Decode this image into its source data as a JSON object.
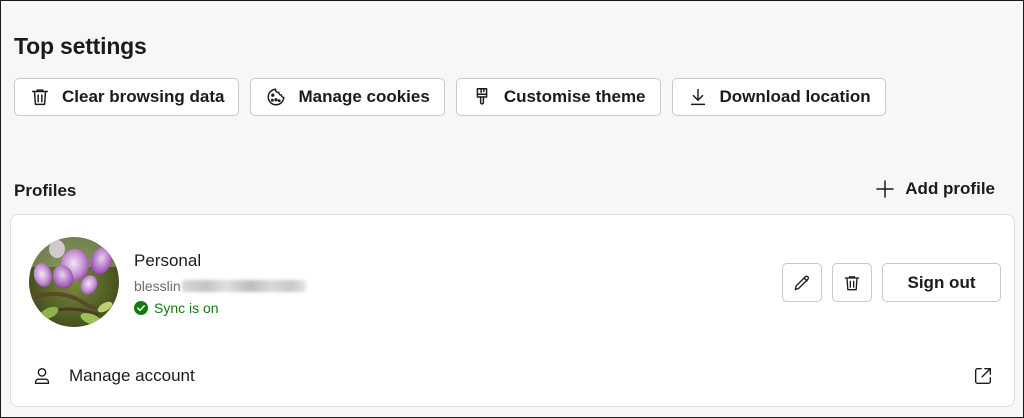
{
  "top_settings": {
    "title": "Top settings",
    "buttons": [
      {
        "label": "Clear browsing data",
        "icon": "trash-icon"
      },
      {
        "label": "Manage cookies",
        "icon": "cookie-icon"
      },
      {
        "label": "Customise theme",
        "icon": "paintbrush-icon"
      },
      {
        "label": "Download location",
        "icon": "download-icon"
      }
    ]
  },
  "profiles": {
    "label": "Profiles",
    "add_profile_label": "Add profile",
    "card": {
      "name": "Personal",
      "email_visible": "blesslin",
      "sync_status": "Sync is on",
      "sign_out_label": "Sign out",
      "manage_account_label": "Manage account"
    }
  },
  "colors": {
    "sync_green": "#107c10",
    "page_background": "#f7f7f7",
    "card_background": "#ffffff",
    "border": "#c9c9c9"
  }
}
